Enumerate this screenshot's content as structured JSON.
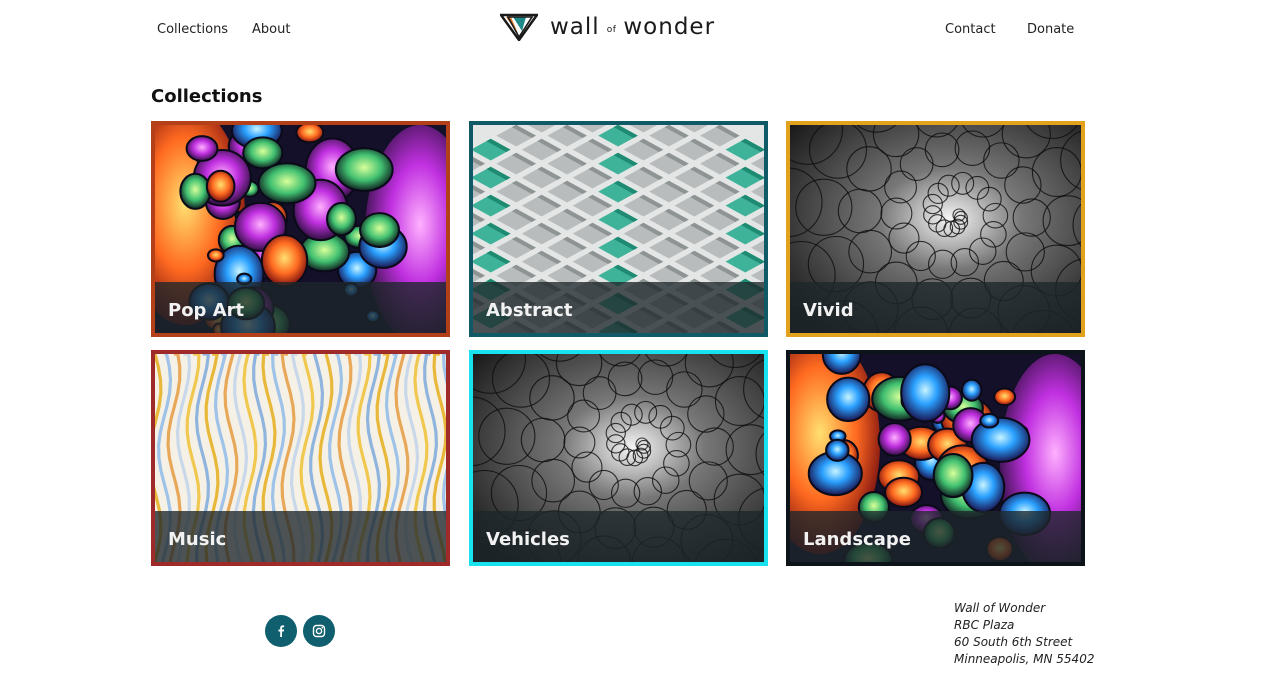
{
  "nav": {
    "left": [
      "Collections",
      "About"
    ],
    "right": [
      "Contact",
      "Donate"
    ],
    "logo": {
      "word1": "wall",
      "word2": "of",
      "word3": "wonder"
    }
  },
  "section_title": "Collections",
  "collections": [
    {
      "label": "Pop Art",
      "border": "#b4401a",
      "art": "pop"
    },
    {
      "label": "Abstract",
      "border": "#0f5a66",
      "art": "abstract"
    },
    {
      "label": "Vivid",
      "border": "#e3a21d",
      "art": "spiral"
    },
    {
      "label": "Music",
      "border": "#9e2a2a",
      "art": "waves"
    },
    {
      "label": "Vehicles",
      "border": "#18e1f0",
      "art": "spiral"
    },
    {
      "label": "Landscape",
      "border": "#0c141a",
      "art": "pop"
    }
  ],
  "footer": {
    "social": [
      "facebook-icon",
      "instagram-icon"
    ],
    "address": [
      "Wall of Wonder",
      "RBC Plaza",
      "60 South 6th Street",
      "Minneapolis, MN 55402"
    ]
  }
}
